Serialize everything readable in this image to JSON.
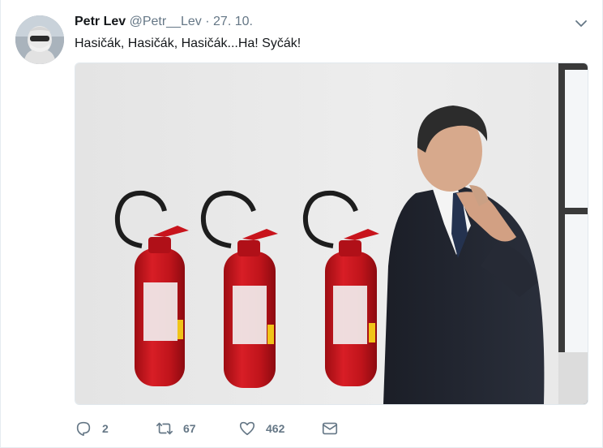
{
  "tweet": {
    "author_name": "Petr Lev",
    "handle": "@Petr__Lev",
    "separator": "·",
    "date": "27. 10.",
    "text": "Hasičák, Hasičák, Hasičák...Ha! Syčák!",
    "avatar_icon": "masked-person-avatar",
    "menu_icon": "chevron-down-icon",
    "media_description_icon": "fire-extinguishers-photo",
    "actions": {
      "reply_count": "2",
      "retweet_count": "67",
      "like_count": "462"
    }
  },
  "colors": {
    "text": "#14171a",
    "secondary_text": "#657786",
    "border": "#e6ecf0",
    "extinguisher_red": "#c8141c"
  }
}
